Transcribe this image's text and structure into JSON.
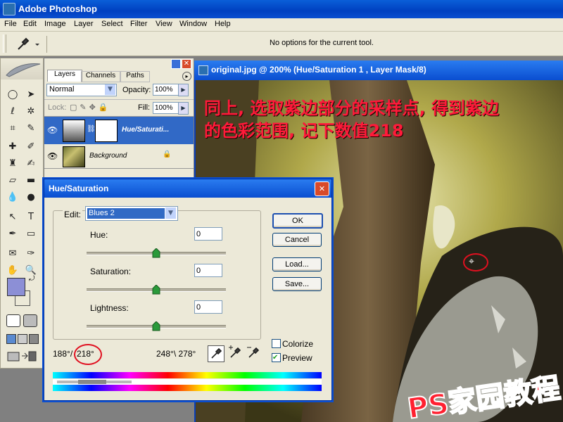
{
  "app": {
    "title": "Adobe Photoshop"
  },
  "menu": [
    "File",
    "Edit",
    "Image",
    "Layer",
    "Select",
    "Filter",
    "View",
    "Window",
    "Help"
  ],
  "options_bar": {
    "message": "No options for the current tool."
  },
  "layers_panel": {
    "tabs": [
      "Layers",
      "Channels",
      "Paths"
    ],
    "blend_mode": "Normal",
    "opacity_label": "Opacity:",
    "opacity_value": "100%",
    "lock_label": "Lock:",
    "fill_label": "Fill:",
    "fill_value": "100%",
    "layers": [
      {
        "name": "Hue/Saturati..."
      },
      {
        "name": "Background"
      }
    ]
  },
  "document": {
    "title": "original.jpg @ 200% (Hue/Saturation 1 , Layer Mask/8)",
    "annotation_line1": "同上, 选取紫边部分的采样点, 得到紫边",
    "annotation_line2": "的色彩范围, 记下数值218",
    "watermark": "PS家园教程"
  },
  "dialog": {
    "title": "Hue/Saturation",
    "edit_label": "Edit:",
    "edit_value": "Blues 2",
    "hue_label": "Hue:",
    "hue_value": "0",
    "saturation_label": "Saturation:",
    "saturation_value": "0",
    "lightness_label": "Lightness:",
    "lightness_value": "0",
    "hue_level": 0.5,
    "saturation_level": 0.5,
    "lightness_level": 0.5,
    "buttons": {
      "ok": "OK",
      "cancel": "Cancel",
      "load": "Load...",
      "save": "Save..."
    },
    "colorize_label": "Colorize",
    "colorize_checked": false,
    "preview_label": "Preview",
    "preview_checked": true,
    "range_left": "188°/",
    "range_left_highlight": "218°",
    "range_right": "248°\\ 278°"
  },
  "colors": {
    "titlebar": "#0a4ed0",
    "annotation": "#ff1a3a",
    "foreground_swatch": "#8c8fd6",
    "background_swatch": "#ffffff"
  }
}
